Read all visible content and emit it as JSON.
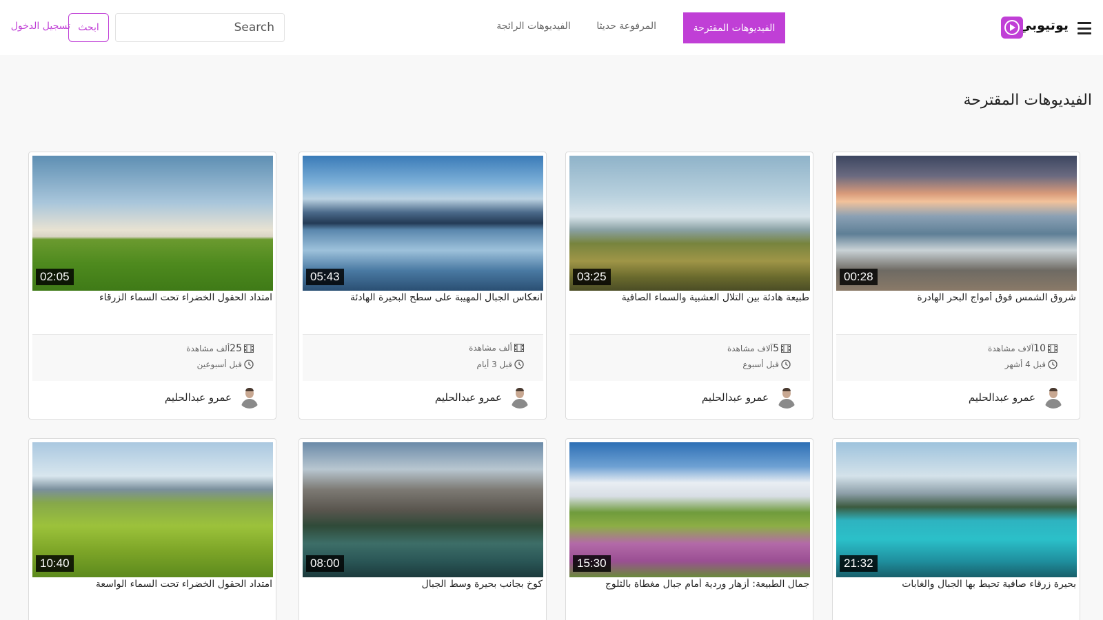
{
  "header": {
    "logo_text": "يوتيوبي",
    "nav": {
      "suggested": "الفيديوهات المقترحة",
      "recent": "المرفوعة حديثا",
      "trending": "الفيديوهات الرائجة"
    },
    "search_placeholder": "Search",
    "search_button": "ابحث",
    "login": "تسجيل الدخول"
  },
  "section_title": "الفيديوهات المقترحة",
  "colors": {
    "accent": "#c03fd6"
  },
  "videos": [
    {
      "title": "شروق الشمس فوق أمواج البحر الهادرة",
      "duration": "00:28",
      "views_num": "10",
      "views_text": "آلاف مشاهدة",
      "time_ago": "قبل 4 أشهر",
      "channel": "عمرو عبدالحليم"
    },
    {
      "title": "طبيعة هادئة بين التلال العشبية والسماء الصافية",
      "duration": "03:25",
      "views_num": "5",
      "views_text": "آلاف مشاهدة",
      "time_ago": "قبل أسبوع",
      "channel": "عمرو عبدالحليم"
    },
    {
      "title": "انعكاس الجبال المهيبة على سطح البحيرة الهادئة",
      "duration": "05:43",
      "views_num": "",
      "views_text": "ألف مشاهدة",
      "time_ago": "قبل 3 أيام",
      "channel": "عمرو عبدالحليم"
    },
    {
      "title": "امتداد الحقول الخضراء تحت السماء الزرقاء",
      "duration": "02:05",
      "views_num": "25",
      "views_text": "ألف مشاهدة",
      "time_ago": "قبل أسبوعين",
      "channel": "عمرو عبدالحليم"
    },
    {
      "title": "بحيرة زرقاء صافية تحيط بها الجبال والغابات",
      "duration": "21:32"
    },
    {
      "title": "جمال الطبيعة: أزهار وردية أمام جبال مغطاة بالثلوج",
      "duration": "15:30"
    },
    {
      "title": "كوخ بجانب بحيرة وسط الجبال",
      "duration": "08:00"
    },
    {
      "title": "امتداد الحقول الخضراء تحت السماء الواسعة",
      "duration": "10:40"
    }
  ]
}
